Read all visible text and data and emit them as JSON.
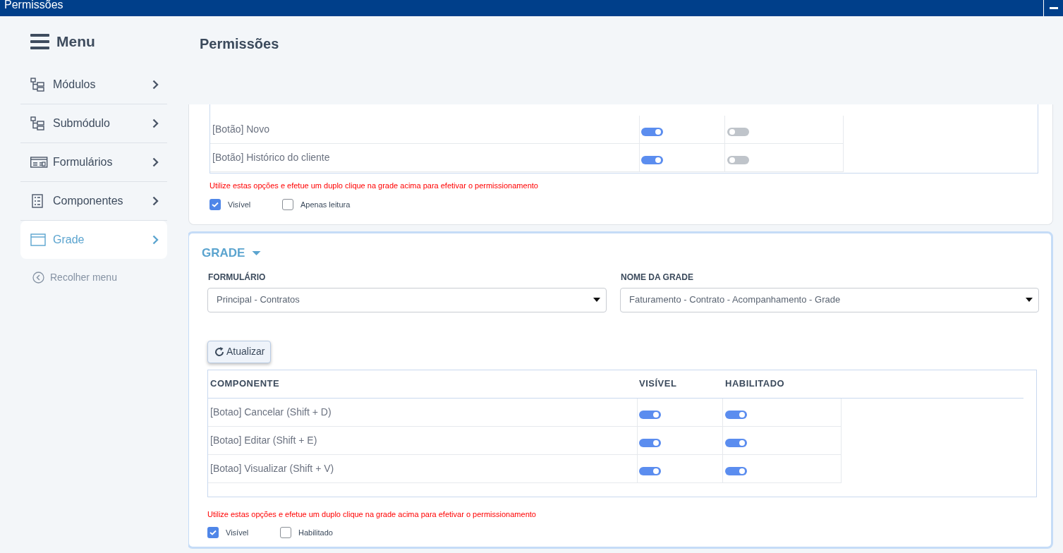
{
  "window": {
    "title": "Permissões"
  },
  "sidebar": {
    "title": "Menu",
    "items": [
      {
        "label": "Módulos",
        "selected": false
      },
      {
        "label": "Submódulo",
        "selected": false
      },
      {
        "label": "Formulários",
        "selected": false
      },
      {
        "label": "Componentes",
        "selected": false
      },
      {
        "label": "Grade",
        "selected": true
      }
    ],
    "collapse_label": "Recolher menu"
  },
  "page_title": "Permissões",
  "components_card": {
    "rows": [
      {
        "component": "[Botão] Novo",
        "visible": true,
        "enabled": false
      },
      {
        "component": "[Botão] Histórico do cliente",
        "visible": true,
        "enabled": false
      }
    ],
    "hint": "Utilize estas opções e efetue um duplo clique na grade acima para efetivar o permissionamento",
    "options": [
      {
        "label": "Visível",
        "checked": true
      },
      {
        "label": "Apenas leitura",
        "checked": false
      }
    ]
  },
  "grade_card": {
    "title": "GRADE",
    "expanded": true,
    "fields": [
      {
        "label": "FORMULÁRIO",
        "value": "Principal - Contratos"
      },
      {
        "label": "NOME DA GRADE",
        "value": "Faturamento - Contrato - Acompanhamento - Grade"
      }
    ],
    "refresh_button": "Atualizar",
    "columns": [
      "COMPONENTE",
      "VISÍVEL",
      "HABILITADO"
    ],
    "rows": [
      {
        "component": "[Botao] Cancelar (Shift + D)",
        "visible": true,
        "enabled": true
      },
      {
        "component": "[Botao] Editar (Shift + E)",
        "visible": true,
        "enabled": true
      },
      {
        "component": "[Botao] Visualizar (Shift + V)",
        "visible": true,
        "enabled": true
      }
    ],
    "hint": "Utilize estas opções e efetue um duplo clique na grade acima para efetivar o permissionamento",
    "options": [
      {
        "label": "Visível",
        "checked": true
      },
      {
        "label": "Habilitado",
        "checked": false
      }
    ]
  }
}
